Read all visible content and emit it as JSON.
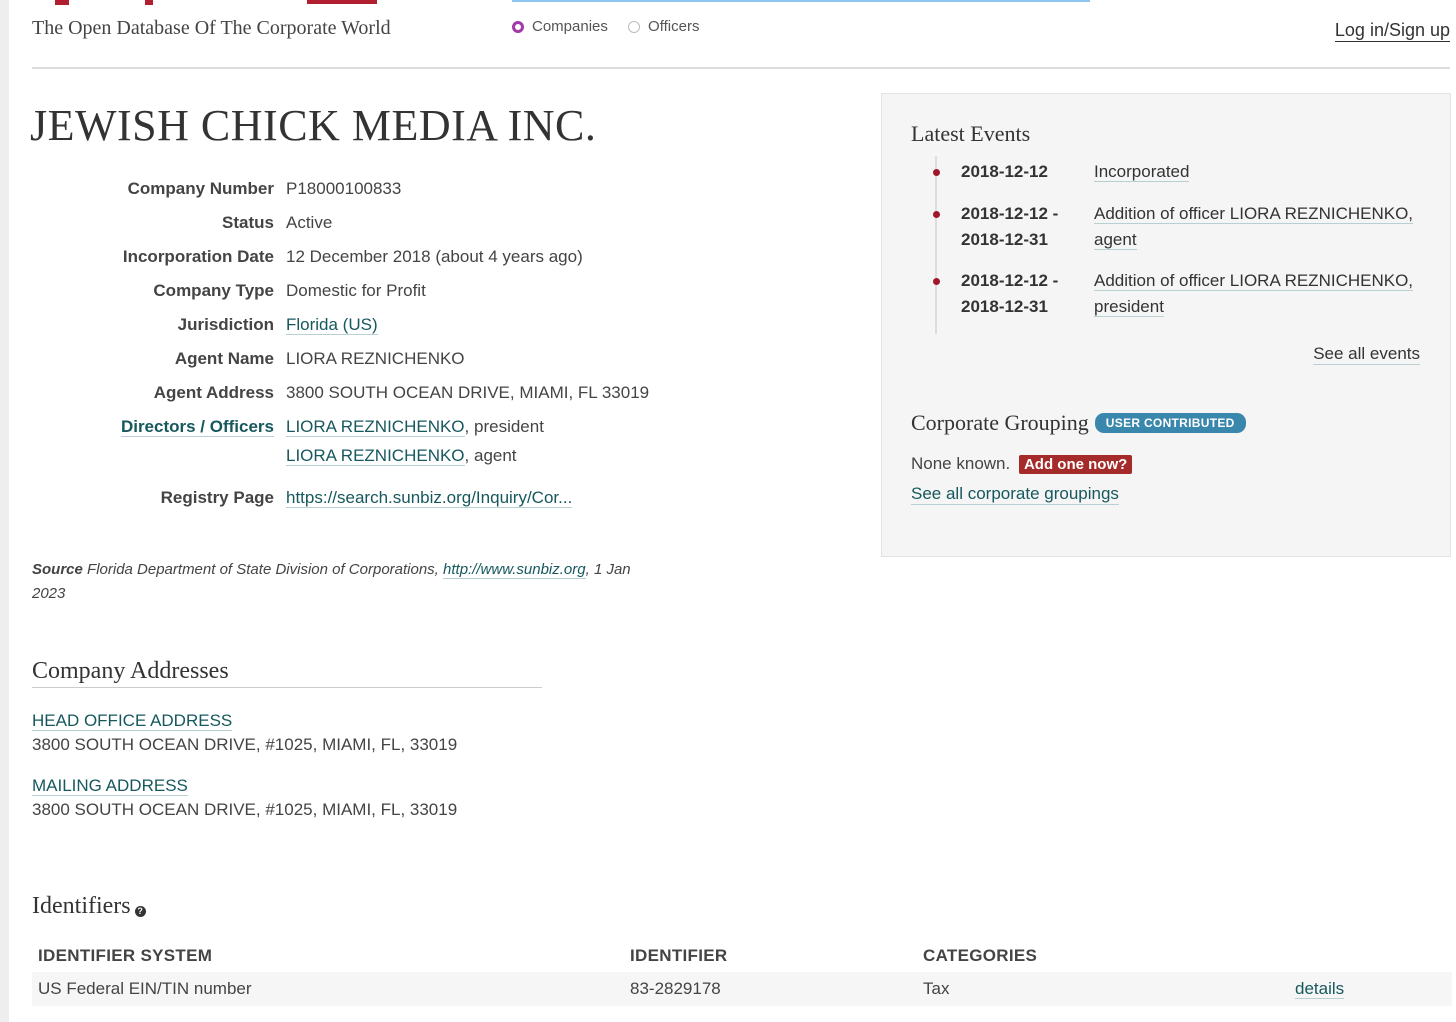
{
  "header": {
    "tagline": "The Open Database Of The Corporate World",
    "search_types": [
      "Companies",
      "Officers"
    ],
    "login_label": "Log in/Sign up"
  },
  "company": {
    "name": "JEWISH CHICK MEDIA INC.",
    "attributes": [
      {
        "label": "Company Number",
        "value": "P18000100833"
      },
      {
        "label": "Status",
        "value": "Active"
      },
      {
        "label": "Incorporation Date",
        "value": "12 December 2018 (about 4 years ago)"
      },
      {
        "label": "Company Type",
        "value": "Domestic for Profit"
      },
      {
        "label": "Jurisdiction",
        "value": "Florida (US)"
      },
      {
        "label": "Agent Name",
        "value": "LIORA REZNICHENKO"
      },
      {
        "label": "Agent Address",
        "value": "3800 SOUTH OCEAN DRIVE, MIAMI, FL 33019"
      }
    ],
    "officers_label": "Directors / Officers",
    "officers": [
      {
        "name": "LIORA REZNICHENKO",
        "role": ", president"
      },
      {
        "name": "LIORA REZNICHENKO",
        "role": ", agent"
      }
    ],
    "registry_label": "Registry Page",
    "registry_url": "https://search.sunbiz.org/Inquiry/Cor..."
  },
  "source": {
    "label": "Source",
    "text": " Florida Department of State Division of Corporations, ",
    "link": "http://www.sunbiz.org",
    "date": ", 1 Jan 2023"
  },
  "addresses": {
    "heading": "Company Addresses",
    "items": [
      {
        "type": "HEAD OFFICE ADDRESS",
        "value": "3800 SOUTH OCEAN DRIVE, #1025, MIAMI, FL, 33019"
      },
      {
        "type": "MAILING ADDRESS",
        "value": "3800 SOUTH OCEAN DRIVE, #1025, MIAMI, FL, 33019"
      }
    ]
  },
  "identifiers": {
    "heading": "Identifiers",
    "help_glyph": "?",
    "columns": [
      "IDENTIFIER SYSTEM",
      "IDENTIFIER",
      "CATEGORIES"
    ],
    "rows": [
      {
        "system": "US Federal EIN/TIN number",
        "identifier": "83-2829178",
        "category": "Tax",
        "action": "details"
      }
    ]
  },
  "latest_events": {
    "heading": "Latest Events",
    "events": [
      {
        "date": "2018-12-12",
        "date_end": "",
        "description": "Incorporated"
      },
      {
        "date": "2018-12-12 -",
        "date_end": "2018-12-31",
        "description": "Addition of officer LIORA REZNICHENKO, agent"
      },
      {
        "date": "2018-12-12 -",
        "date_end": "2018-12-31",
        "description": "Addition of officer LIORA REZNICHENKO, president"
      }
    ],
    "see_all": "See all events"
  },
  "corporate_grouping": {
    "heading": "Corporate Grouping",
    "badge": "USER CONTRIBUTED",
    "none_known": "None known.",
    "add_one": "Add one now?",
    "see_all": "See all corporate groupings"
  },
  "colors": {
    "accent_link": "#16585d",
    "event_dot": "#a0172b",
    "badge": "#3a87ad",
    "add_button": "#a52a2a",
    "radio_selected": "#a239a8"
  }
}
